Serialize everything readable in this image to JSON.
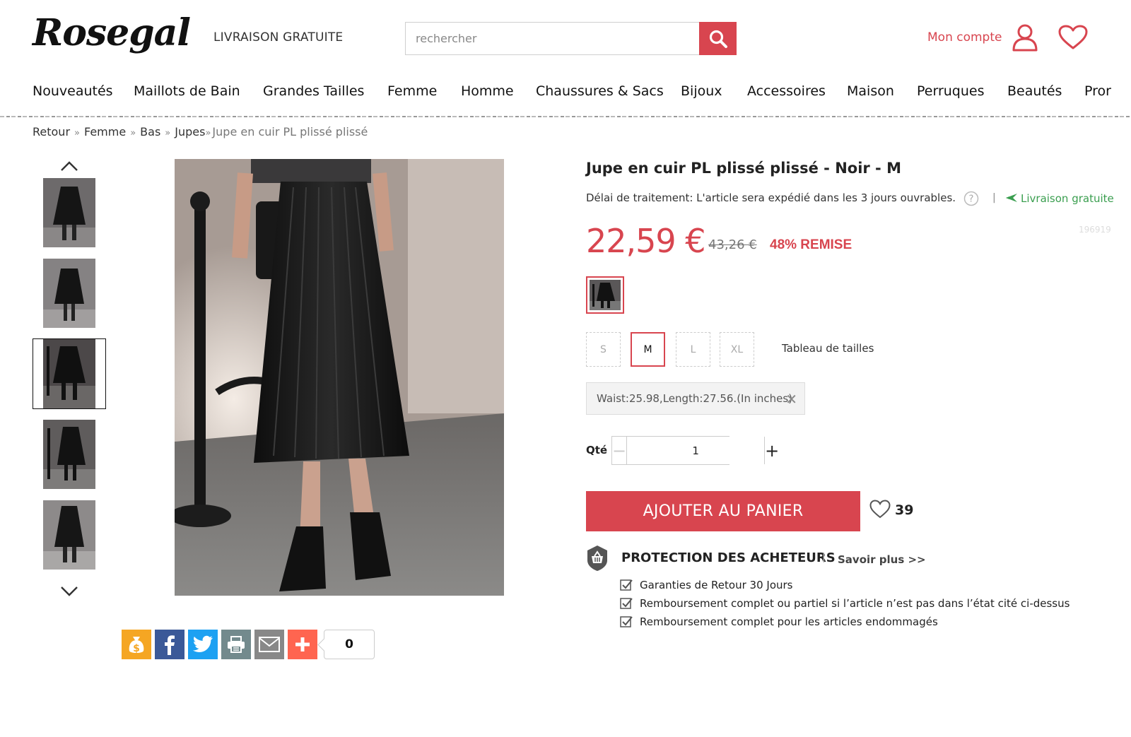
{
  "header": {
    "logo": "Rosegal",
    "free_shipping": "LIVRAISON GRATUITE",
    "search_placeholder": "rechercher",
    "account_label": "Mon compte"
  },
  "nav": {
    "items": [
      "Nouveautés",
      "Maillots de Bain",
      "Grandes Tailles",
      "Femme",
      "Homme",
      "Chaussures & Sacs",
      "Bijoux",
      "Accessoires",
      "Maison",
      "Perruques",
      "Beautés",
      "Pror"
    ]
  },
  "breadcrumb": {
    "items": [
      "Retour",
      "Femme",
      "Bas",
      "Jupes"
    ],
    "current": "Jupe en cuir PL plissé plissé",
    "separator": "»"
  },
  "product": {
    "title": "Jupe en cuir PL plissé plissé - Noir - M",
    "lead_time": "Délai de traitement: L'article sera expédié dans les 3 jours ouvrables.",
    "shipping": "Livraison gratuite",
    "sku": "196919",
    "price": "22,59 €",
    "old_price": "43,26 €",
    "discount": "48% REMISE",
    "sizes": [
      "S",
      "M",
      "L",
      "XL"
    ],
    "selected_size": "M",
    "size_chart_label": "Tableau de tailles",
    "measurements": "Waist:25.98,Length:27.56.(In inches)",
    "qty_label": "Qté",
    "qty_value": "1",
    "add_to_cart": "AJOUTER AU PANIER",
    "wishlist_count": "39"
  },
  "protection": {
    "title": "PROTECTION DES ACHETEURS",
    "learn_more": "Savoir plus >>",
    "items": [
      "Garanties de Retour 30 Jours",
      "Remboursement complet ou partiel si l’article n’est pas dans l’état cité ci-dessus",
      "Remboursement complet pour les articles endommagés"
    ]
  },
  "share": {
    "count": "0",
    "buttons": [
      "earn-icon",
      "facebook-icon",
      "twitter-icon",
      "print-icon",
      "email-icon",
      "more-share-icon"
    ]
  },
  "colors": {
    "accent": "#d8454f",
    "shipping_green": "#3a9e4f",
    "facebook": "#3b5998",
    "twitter": "#1da1f2",
    "print": "#738a8d",
    "email": "#888888",
    "more": "#ff6550",
    "earn": "#f5a623"
  }
}
